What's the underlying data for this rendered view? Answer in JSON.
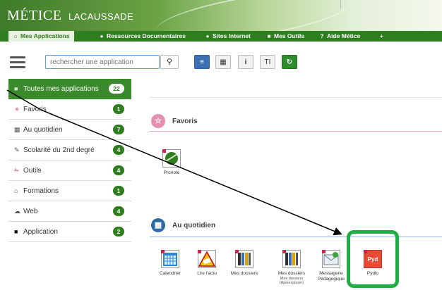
{
  "header": {
    "logo_main": "MÉTICE",
    "logo_sub": "LACAUSSADE"
  },
  "nav": {
    "items": [
      {
        "icon": "home-icon",
        "label": "Mes Applications"
      },
      {
        "icon": "globe-icon",
        "label": "Ressources Documentaires"
      },
      {
        "icon": "globe-icon",
        "label": "Sites Internet"
      },
      {
        "icon": "folder-icon",
        "label": "Mes Outils"
      },
      {
        "icon": "question-icon",
        "label": "Aide Métice"
      },
      {
        "icon": "plus-icon",
        "label": "+"
      }
    ]
  },
  "toolbar": {
    "search_placeholder": "rechercher une application",
    "search_icon": "search-icon",
    "btn_list": "≡",
    "btn_grid": "▦",
    "btn_info": "i",
    "btn_text": "TI",
    "btn_refresh": "↻"
  },
  "sidebar": {
    "items": [
      {
        "label": "Toutes mes applications",
        "count": "22",
        "icon": "square-icon"
      },
      {
        "label": "Favoris",
        "count": "1",
        "icon": "star-icon"
      },
      {
        "label": "Au quotidien",
        "count": "7",
        "icon": "calendar-icon"
      },
      {
        "label": "Scolarité du 2nd degré",
        "count": "4",
        "icon": "edit-icon"
      },
      {
        "label": "Outils",
        "count": "4",
        "icon": "wrench-icon"
      },
      {
        "label": "Formations",
        "count": "1",
        "icon": "graduation-icon"
      },
      {
        "label": "Web",
        "count": "4",
        "icon": "cloud-icon"
      },
      {
        "label": "Application",
        "count": "2",
        "icon": "square-icon"
      }
    ]
  },
  "sections": {
    "favoris": {
      "title": "Favoris",
      "apps": [
        {
          "label": "Pronote"
        }
      ]
    },
    "quotidien": {
      "title": "Au quotidien",
      "apps": [
        {
          "label": "Calendrier"
        },
        {
          "label": "Lire l'actu"
        },
        {
          "label": "Mes dossiers"
        },
        {
          "label": "Mes dossiers",
          "sub1": "Mes dossiers",
          "sub2": "(Ajaxexplorer)"
        },
        {
          "label": "Messagerie",
          "sub1": "Pédagogique"
        },
        {
          "label": "Pydio"
        }
      ]
    }
  },
  "colors": {
    "accent": "#2e7d1e",
    "highlight": "#1fae45",
    "arrow": "#000000"
  }
}
